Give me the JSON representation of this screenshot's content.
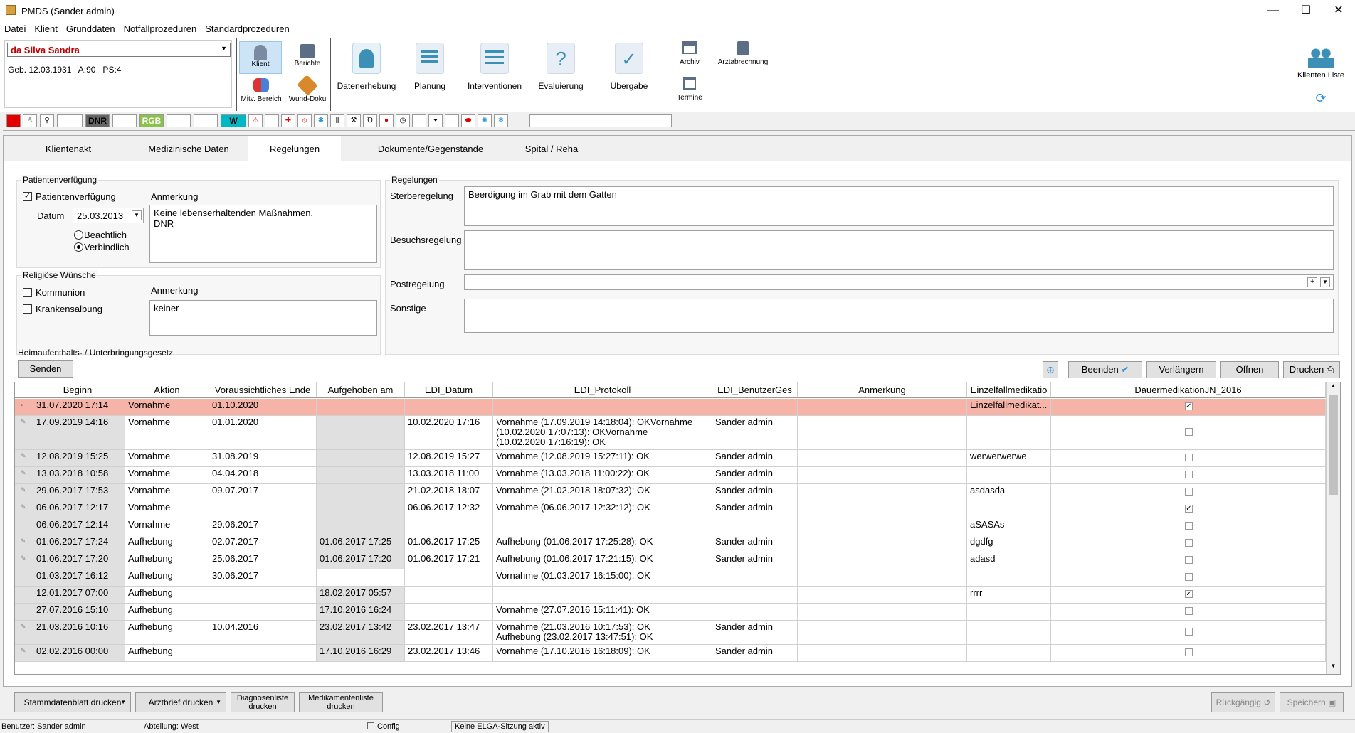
{
  "window": {
    "title": "PMDS (Sander admin)",
    "min": "—",
    "max": "☐",
    "close": "✕"
  },
  "menu": [
    "Datei",
    "Klient",
    "Grunddaten",
    "Notfallprozeduren",
    "Standardprozeduren"
  ],
  "patient": {
    "name": "da Silva Sandra",
    "info": "Geb. 12.03.1931   A:90   PS:4"
  },
  "tools_small": [
    {
      "label": "Klient"
    },
    {
      "label": "Berichte"
    },
    {
      "label": "Mitv. Bereich"
    },
    {
      "label": "Wund-Doku"
    }
  ],
  "tools_big": [
    {
      "label": "Datenerhebung"
    },
    {
      "label": "Planung"
    },
    {
      "label": "Interventionen"
    },
    {
      "label": "Evaluierung"
    },
    {
      "label": "Übergabe"
    }
  ],
  "tools_right": [
    {
      "label": "Archiv"
    },
    {
      "label": "Arztabrechnung"
    },
    {
      "label": "Termine"
    }
  ],
  "klienten_liste": "Klienten Liste",
  "iconbar": {
    "dnr": "DNR",
    "rgb": "RGB",
    "w": "W"
  },
  "tabs": [
    "Klientenakt",
    "Medizinische Daten",
    "Regelungen",
    "Dokumente/Gegenstände",
    "Spital / Reha"
  ],
  "patientenverfuegung": {
    "legend": "Patientenverfügung",
    "checkbox_label": "Patientenverfügung",
    "checked": "✓",
    "datum_label": "Datum",
    "datum_value": "25.03.2013",
    "anmerkung_label": "Anmerkung",
    "anmerkung_value": "Keine lebenserhaltenden Maßnahmen.\nDNR",
    "beachtlich": "Beachtlich",
    "verbindlich": "Verbindlich"
  },
  "religioese": {
    "legend": "Religiöse Wünsche",
    "kommunion": "Kommunion",
    "krankensalbung": "Krankensalbung",
    "anmerkung_label": "Anmerkung",
    "anmerkung_value": "keiner"
  },
  "regelungen": {
    "legend": "Regelungen",
    "sterbe_label": "Sterberegelung",
    "sterbe_value": "Beerdigung im Grab mit dem Gatten",
    "besuchs_label": "Besuchsregelung",
    "besuchs_value": "",
    "post_label": "Postregelung",
    "post_value": "",
    "sonstige_label": "Sonstige",
    "sonstige_value": ""
  },
  "heim": {
    "legend": "Heimaufenthalts- / Unterbringungsgesetz",
    "senden": "Senden",
    "beenden": "Beenden",
    "verlaengern": "Verlängern",
    "oeffnen": "Öffnen",
    "drucken": "Drucken"
  },
  "columns": [
    "Beginn",
    "Aktion",
    "Voraussichtliches Ende",
    "Aufgehoben am",
    "EDI_Datum",
    "EDI_Protokoll",
    "EDI_BenutzerGes",
    "Anmerkung",
    "Einzelfallmedikatio",
    "DauermedikationJN_2016"
  ],
  "rows": [
    {
      "beginn": "31.07.2020 17:14",
      "aktion": "Vornahme",
      "ende": "01.10.2020",
      "aufgehoben": "",
      "edi_datum": "",
      "protokoll": "",
      "benutzer": "",
      "anmerkung": "",
      "einzel": "Einzelfallmedikat...",
      "dauer": true
    },
    {
      "beginn": "17.09.2019 14:16",
      "aktion": "Vornahme",
      "ende": "01.01.2020",
      "aufgehoben": "",
      "edi_datum": "10.02.2020 17:16",
      "protokoll": "Vornahme (17.09.2019 14:18:04): OKVornahme\n(10.02.2020 17:07:13): OKVornahme\n(10.02.2020 17:16:19): OK",
      "benutzer": "Sander admin",
      "anmerkung": "",
      "einzel": "",
      "dauer": false
    },
    {
      "beginn": "12.08.2019 15:25",
      "aktion": "Vornahme",
      "ende": "31.08.2019",
      "aufgehoben": "",
      "edi_datum": "12.08.2019 15:27",
      "protokoll": "Vornahme (12.08.2019 15:27:11): OK",
      "benutzer": "Sander admin",
      "anmerkung": "",
      "einzel": "werwerwerwe",
      "dauer": false
    },
    {
      "beginn": "13.03.2018 10:58",
      "aktion": "Vornahme",
      "ende": "04.04.2018",
      "aufgehoben": "",
      "edi_datum": "13.03.2018 11:00",
      "protokoll": "Vornahme (13.03.2018 11:00:22): OK",
      "benutzer": "Sander admin",
      "anmerkung": "",
      "einzel": "",
      "dauer": false
    },
    {
      "beginn": "29.06.2017 17:53",
      "aktion": "Vornahme",
      "ende": "09.07.2017",
      "aufgehoben": "",
      "edi_datum": "21.02.2018 18:07",
      "protokoll": "Vornahme (21.02.2018 18:07:32): OK",
      "benutzer": "Sander admin",
      "anmerkung": "",
      "einzel": "asdasda",
      "dauer": false
    },
    {
      "beginn": "06.06.2017 12:17",
      "aktion": "Vornahme",
      "ende": "",
      "aufgehoben": "",
      "edi_datum": "06.06.2017 12:32",
      "protokoll": "Vornahme (06.06.2017 12:32:12): OK",
      "benutzer": "Sander admin",
      "anmerkung": "",
      "einzel": "",
      "dauer": true
    },
    {
      "beginn": "06.06.2017 12:14",
      "aktion": "Vornahme",
      "ende": "29.06.2017",
      "aufgehoben": "",
      "edi_datum": "",
      "protokoll": "",
      "benutzer": "",
      "anmerkung": "",
      "einzel": "aSASAs",
      "dauer": false
    },
    {
      "beginn": "01.06.2017 17:24",
      "aktion": "Aufhebung",
      "ende": "02.07.2017",
      "aufgehoben": "01.06.2017 17:25",
      "edi_datum": "01.06.2017 17:25",
      "protokoll": "Aufhebung (01.06.2017 17:25:28): OK",
      "benutzer": "Sander admin",
      "anmerkung": "",
      "einzel": "dgdfg",
      "dauer": false
    },
    {
      "beginn": "01.06.2017 17:20",
      "aktion": "Aufhebung",
      "ende": "25.06.2017",
      "aufgehoben": "01.06.2017 17:20",
      "edi_datum": "01.06.2017 17:21",
      "protokoll": "Aufhebung (01.06.2017 17:21:15): OK",
      "benutzer": "Sander admin",
      "anmerkung": "",
      "einzel": "adasd",
      "dauer": false
    },
    {
      "beginn": "01.03.2017 16:12",
      "aktion": "Aufhebung",
      "ende": "30.06.2017",
      "aufgehoben": "",
      "edi_datum": "",
      "protokoll": "Vornahme (01.03.2017 16:15:00): OK",
      "benutzer": "",
      "anmerkung": "",
      "einzel": "",
      "dauer": false
    },
    {
      "beginn": "12.01.2017 07:00",
      "aktion": "Aufhebung",
      "ende": "",
      "aufgehoben": "18.02.2017 05:57",
      "edi_datum": "",
      "protokoll": "",
      "benutzer": "",
      "anmerkung": "",
      "einzel": "rrrr",
      "dauer": true
    },
    {
      "beginn": "27.07.2016 15:10",
      "aktion": "Aufhebung",
      "ende": "",
      "aufgehoben": "17.10.2016 16:24",
      "edi_datum": "",
      "protokoll": "Vornahme (27.07.2016 15:11:41): OK",
      "benutzer": "",
      "anmerkung": "",
      "einzel": "",
      "dauer": false
    },
    {
      "beginn": "21.03.2016 10:16",
      "aktion": "Aufhebung",
      "ende": "10.04.2016",
      "aufgehoben": "23.02.2017 13:42",
      "edi_datum": "23.02.2017 13:47",
      "protokoll": "Vornahme (21.03.2016 10:17:53): OK\nAufhebung (23.02.2017 13:47:51): OK",
      "benutzer": "Sander admin",
      "anmerkung": "",
      "einzel": "",
      "dauer": false
    },
    {
      "beginn": "02.02.2016 00:00",
      "aktion": "Aufhebung",
      "ende": "",
      "aufgehoben": "17.10.2016 16:29",
      "edi_datum": "23.02.2017 13:46",
      "protokoll": "Vornahme (17.10.2016 16:18:09): OK",
      "benutzer": "Sander admin",
      "anmerkung": "",
      "einzel": "",
      "dauer": false
    }
  ],
  "bottom": {
    "stammdaten": "Stammdatenblatt drucken",
    "arztbrief": "Arztbrief drucken",
    "diagnosen": "Diagnosenliste\ndrucken",
    "medikamente": "Medikamentenliste\ndrucken",
    "rueckgaengig": "Rückgängig",
    "speichern": "Speichern"
  },
  "status": {
    "benutzer": "Benutzer: Sander admin",
    "abteilung": "Abteilung: West",
    "config": "Config",
    "elga": "Keine ELGA-Sitzung aktiv"
  }
}
